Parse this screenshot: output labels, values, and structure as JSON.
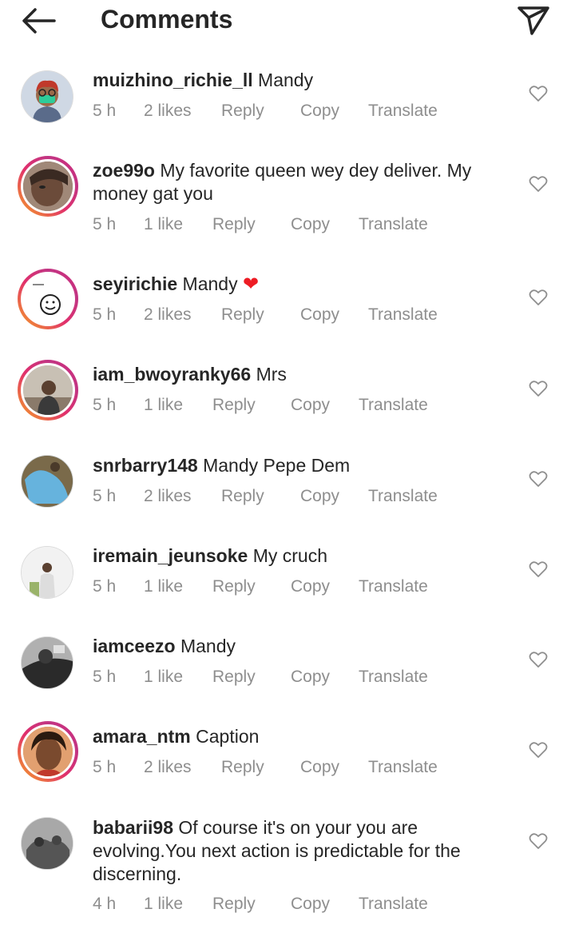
{
  "header": {
    "title": "Comments",
    "back_icon": "arrow-left-icon",
    "share_icon": "paper-plane-icon"
  },
  "comments": [
    {
      "username": "muizhino_richie_ll",
      "text": "Mandy",
      "time": "5 h",
      "likes": "2 likes",
      "reply": "Reply",
      "copy": "Copy",
      "translate": "Translate"
    },
    {
      "username": "zoe99o",
      "text": "My favorite queen wey dey deliver. My money gat you",
      "time": "5 h",
      "likes": "1 like",
      "reply": "Reply",
      "copy": "Copy",
      "translate": "Translate"
    },
    {
      "username": "seyirichie",
      "text": "Mandy",
      "time": "5 h",
      "likes": "2 likes",
      "reply": "Reply",
      "copy": "Copy",
      "translate": "Translate",
      "emoji": "❤"
    },
    {
      "username": "iam_bwoyranky66",
      "text": "Mrs",
      "time": "5 h",
      "likes": "1 like",
      "reply": "Reply",
      "copy": "Copy",
      "translate": "Translate"
    },
    {
      "username": "snrbarry148",
      "text": "Mandy Pepe Dem",
      "time": "5 h",
      "likes": "2 likes",
      "reply": "Reply",
      "copy": "Copy",
      "translate": "Translate"
    },
    {
      "username": "iremain_jeunsoke",
      "text": "My cruch",
      "time": "5 h",
      "likes": "1 like",
      "reply": "Reply",
      "copy": "Copy",
      "translate": "Translate"
    },
    {
      "username": "iamceezo",
      "text": "Mandy",
      "time": "5 h",
      "likes": "1 like",
      "reply": "Reply",
      "copy": "Copy",
      "translate": "Translate"
    },
    {
      "username": "amara_ntm",
      "text": "Caption",
      "time": "5 h",
      "likes": "2 likes",
      "reply": "Reply",
      "copy": "Copy",
      "translate": "Translate"
    },
    {
      "username": "babarii98",
      "text": "Of course it's on your you are evolving.You next action is predictable for the discerning.",
      "time": "4 h",
      "likes": "1 like",
      "reply": "Reply",
      "copy": "Copy",
      "translate": "Translate"
    }
  ],
  "colors": {
    "text": "#262626",
    "meta": "#8e8e8e",
    "emoji_heart": "#ed1c24"
  }
}
